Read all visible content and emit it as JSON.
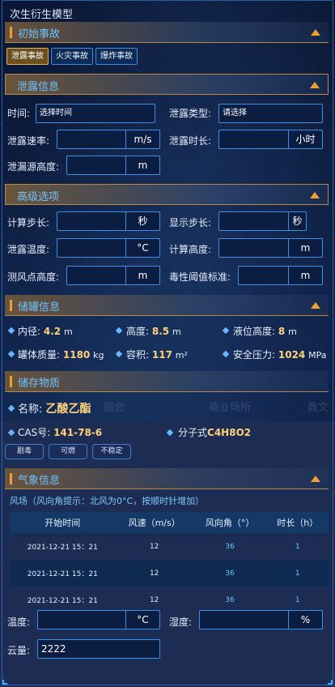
{
  "window": {
    "title": "次生衍生模型"
  },
  "sections": {
    "initial": "初始事故",
    "leak": "泄露信息",
    "advanced": "高级选项",
    "tank": "储罐信息",
    "substance": "储存物质",
    "weather": "气象信息"
  },
  "accident_types": [
    {
      "label": "泄露事故",
      "active": true
    },
    {
      "label": "火灾事故",
      "active": false
    },
    {
      "label": "爆炸事故",
      "active": false
    }
  ],
  "leak": {
    "time_label": "时间:",
    "time_placeholder": "选择时间",
    "type_label": "泄露类型:",
    "type_placeholder": "请选择",
    "rate_label": "泄露速率:",
    "rate_unit": "m/s",
    "duration_label": "泄露时长:",
    "duration_unit": "小时",
    "height_label": "泄漏源高度:",
    "height_unit": "m"
  },
  "advanced": {
    "calc_step_label": "计算步长:",
    "calc_step_unit": "秒",
    "display_step_label": "显示步长:",
    "display_step_unit": "秒",
    "leak_temp_label": "泄露温度:",
    "leak_temp_unit": "°C",
    "calc_height_label": "计算高度:",
    "calc_height_unit": "m",
    "wind_point_label": "测风点高度:",
    "wind_point_unit": "m",
    "toxic_label": "毒性阈值标准:",
    "toxic_unit": "m"
  },
  "tank": {
    "inner_d_label": "内径:",
    "inner_d_value": "4.2",
    "inner_d_unit": "m",
    "height_label": "高度:",
    "height_value": "8.5",
    "height_unit": "m",
    "liquid_label": "液位高度:",
    "liquid_value": "8",
    "liquid_unit": "m",
    "mass_label": "罐体质量:",
    "mass_value": "1180",
    "mass_unit": "kg",
    "volume_label": "容积:",
    "volume_value": "117",
    "volume_unit": "m²",
    "pressure_label": "安全压力:",
    "pressure_value": "1024",
    "pressure_unit": "MPa"
  },
  "substance": {
    "name_label": "名称:",
    "name_value": "乙酸乙酯",
    "cas_label": "CAS号:",
    "cas_value": "141-78-6",
    "formula_label": "分子式",
    "formula_value": "C4H8O2",
    "tags": [
      "剧毒",
      "可燃",
      "不稳定"
    ]
  },
  "map_labels": [
    "综合",
    "商业场所",
    "教文"
  ],
  "weather": {
    "note": "风场（风向角提示：北风为0°C，按顺时针增加）",
    "columns": [
      "开始时间",
      "风速（m/s）",
      "风向角（°）",
      "时长（h）"
    ],
    "rows": [
      [
        "2021-12-21 15：21",
        "12",
        "36",
        "1"
      ],
      [
        "2021-12-21 15：21",
        "12",
        "36",
        "1"
      ],
      [
        "2021-12-21 15：21",
        "12",
        "36",
        "1"
      ]
    ],
    "temp_label": "温度:",
    "temp_unit": "°C",
    "humidity_label": "湿度:",
    "humidity_unit": "%",
    "cloud_label": "云量:",
    "cloud_value": "2222"
  }
}
